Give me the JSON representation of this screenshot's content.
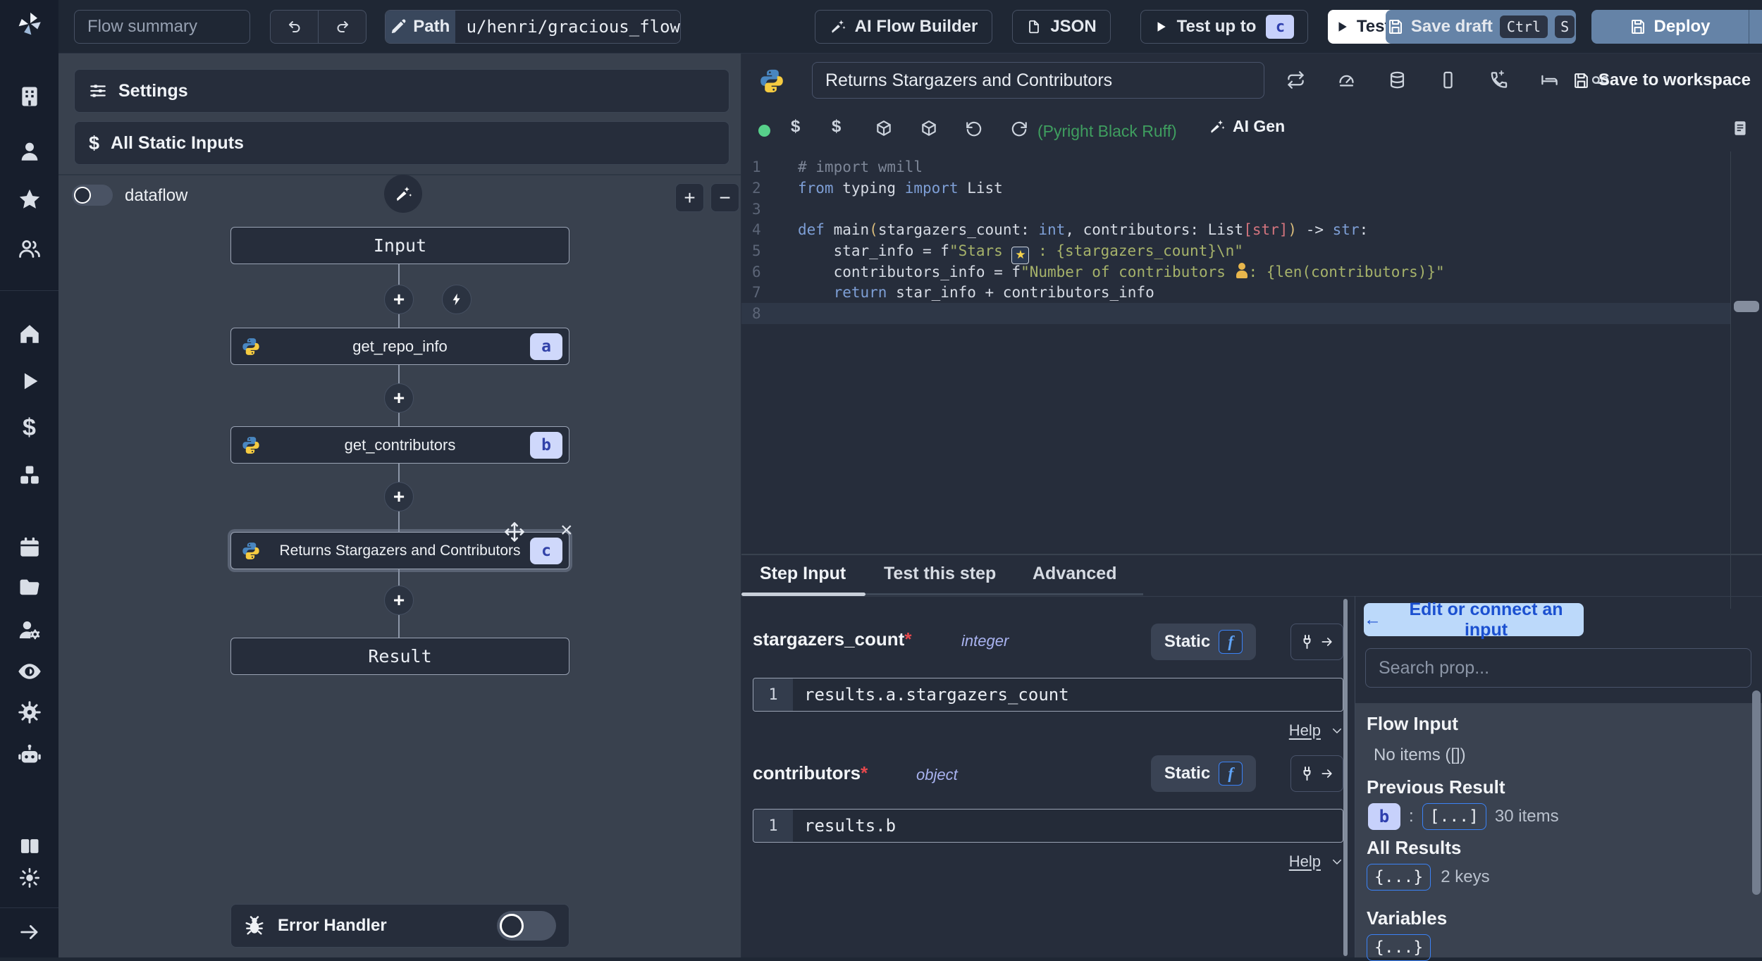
{
  "glyphs": {
    "dollar": "$",
    "plus": "+",
    "minus": "−",
    "close": "×",
    "colon": ":",
    "edit_arrow": "←"
  },
  "colors": {
    "accent_blue": "#3b82f6",
    "badge_bg": "#cfd8fb",
    "badge_text": "#3242a8",
    "save_button_blue": "#6583a7",
    "lint_green": "#3f9e5f",
    "string_green": "#a6b26a",
    "keyword_blue": "#7e9fd6",
    "panel_bg": "#39414e",
    "editor_bg": "#262d3b"
  },
  "sidebar": {
    "icons": [
      "windmill-logo",
      "building",
      "user",
      "star",
      "users",
      "home",
      "play",
      "dollar",
      "cubes",
      "calendar",
      "folder",
      "user-cog",
      "eye",
      "gear",
      "bot",
      "books",
      "sun",
      "arrow-right"
    ]
  },
  "topbar": {
    "flow_summary": "Flow summary",
    "path_label": "Path",
    "path_value": "u/henri/gracious_flow",
    "ai_flow_builder": "AI Flow Builder",
    "json_label": "JSON",
    "test_up_to": "Test up to",
    "test_badge": "c",
    "test_flow": "Test flow",
    "save_draft": "Save draft",
    "kbd": [
      "Ctrl",
      "S"
    ],
    "deploy": "Deploy"
  },
  "flow": {
    "settings": "Settings",
    "all_static_inputs": "All Static Inputs",
    "dataflow_label": "dataflow",
    "input_node": "Input",
    "result_node": "Result",
    "steps": [
      {
        "label": "get_repo_info",
        "badge": "a"
      },
      {
        "label": "get_contributors",
        "badge": "b"
      },
      {
        "label": "Returns Stargazers and Contributors",
        "badge": "c"
      }
    ],
    "error_handler": "Error Handler"
  },
  "editor": {
    "step_name": "Returns Stargazers and Contributors",
    "save_to_workspace": "Save to workspace",
    "lint": "(Pyright Black Ruff)",
    "ai_gen": "AI Gen",
    "code": {
      "gutter": [
        "1",
        "2",
        "3",
        "4",
        "5",
        "6",
        "7",
        "8"
      ],
      "l1": "# import wmill",
      "l2": {
        "k1": "from",
        "t1": " typing ",
        "k2": "import",
        "t2": " List"
      },
      "l4": {
        "k1": "def",
        "t1": " main",
        "p1": "(",
        "t2": "stargazers_count: ",
        "k2": "int",
        "t3": ", contributors: List",
        "r1": "[str]",
        "p2": ")",
        "t4": " -> ",
        "k3": "str",
        "t5": ":"
      },
      "l5": {
        "t1": "    star_info = f",
        "s1": "\"Stars ",
        "star": "★",
        "s2": " : {stargazers_count}\\n\""
      },
      "l6": {
        "t1": "    contributors_info = f",
        "s1": "\"Number of contributors ",
        "s2": ": {len(contributors)}\""
      },
      "l7": {
        "t1": "    ",
        "k1": "return",
        "t2": " star_info + contributors_info"
      }
    }
  },
  "step_panel": {
    "tabs": [
      "Step Input",
      "Test this step",
      "Advanced"
    ],
    "fn": "f",
    "fields": [
      {
        "name": "stargazers_count",
        "req": "*",
        "type": "integer",
        "mode": "Static",
        "gutter": "1",
        "expr": "results.a.stargazers_count",
        "help": "Help"
      },
      {
        "name": "contributors",
        "req": "*",
        "type": "object",
        "mode": "Static",
        "gutter": "1",
        "expr": "results.b",
        "help": "Help"
      }
    ]
  },
  "connect": {
    "edit_label": "Edit or connect an input",
    "search_placeholder": "Search prop...",
    "flow_input": "Flow Input",
    "flow_input_empty": "No items ([])",
    "previous_result": "Previous Result",
    "prev_badge": "b",
    "prev_chip": "[...]",
    "prev_count": "30 items",
    "all_results": "All Results",
    "all_chip": "{...}",
    "all_count": "2 keys",
    "variables": "Variables",
    "vars_chip": "{...}"
  }
}
